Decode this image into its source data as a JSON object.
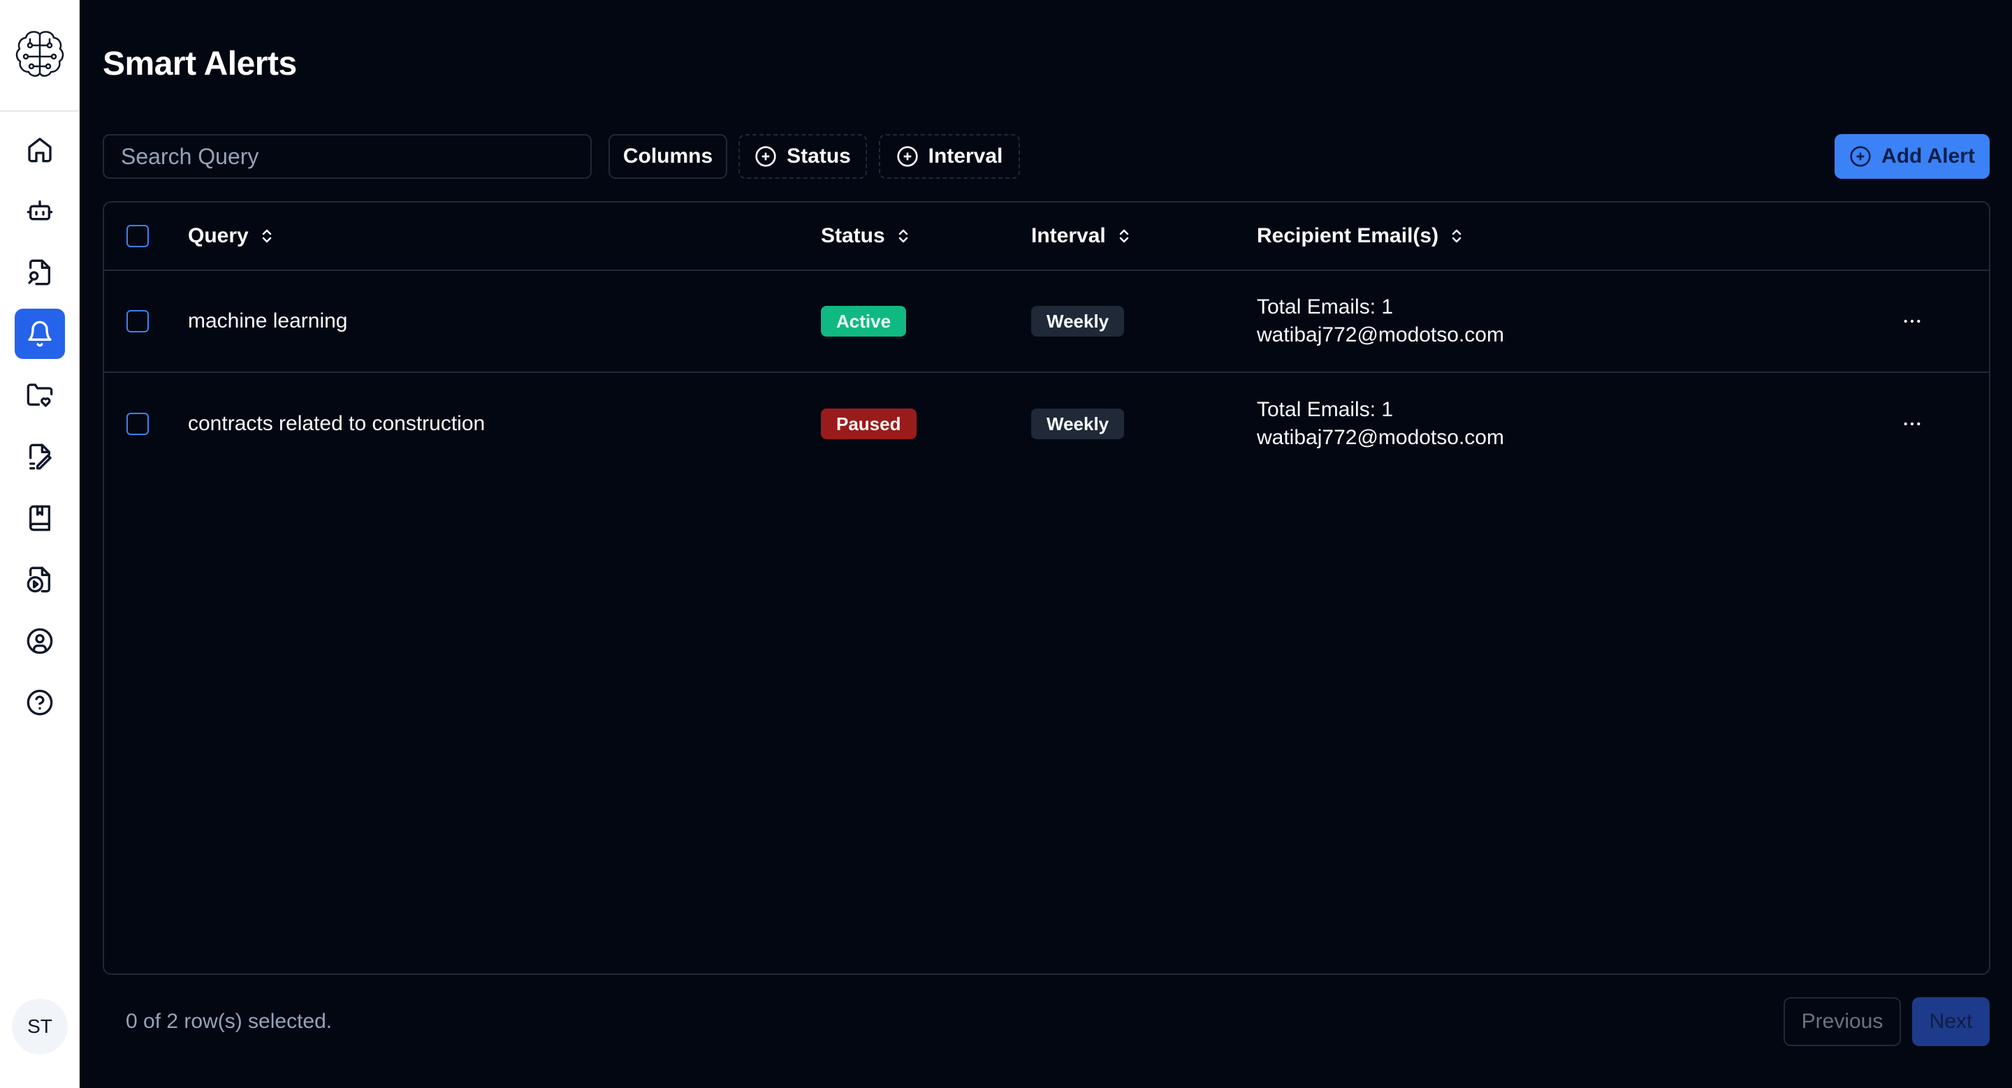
{
  "sidebar": {
    "logo_icon": "brain-icon",
    "items": [
      {
        "name": "home",
        "icon": "home-icon",
        "active": false
      },
      {
        "name": "bot",
        "icon": "bot-icon",
        "active": false
      },
      {
        "name": "file-search",
        "icon": "file-search-icon",
        "active": false
      },
      {
        "name": "alerts",
        "icon": "bell-icon",
        "active": true
      },
      {
        "name": "folder-heart",
        "icon": "folder-heart-icon",
        "active": false
      },
      {
        "name": "file-edit",
        "icon": "file-edit-icon",
        "active": false
      },
      {
        "name": "book",
        "icon": "book-icon",
        "active": false
      },
      {
        "name": "file-video",
        "icon": "file-video-icon",
        "active": false
      },
      {
        "name": "account",
        "icon": "user-circle-icon",
        "active": false
      },
      {
        "name": "help",
        "icon": "help-circle-icon",
        "active": false
      }
    ],
    "avatar_initials": "ST"
  },
  "page": {
    "title": "Smart Alerts"
  },
  "toolbar": {
    "search_placeholder": "Search Query",
    "columns_label": "Columns",
    "status_label": "Status",
    "interval_label": "Interval",
    "add_label": "Add Alert"
  },
  "table": {
    "headers": {
      "query": "Query",
      "status": "Status",
      "interval": "Interval",
      "recipients": "Recipient Email(s)"
    },
    "rows": [
      {
        "query": "machine learning",
        "status": "Active",
        "interval": "Weekly",
        "total": "Total Emails: 1",
        "email": "watibaj772@modotso.com"
      },
      {
        "query": "contracts related to construction",
        "status": "Paused",
        "interval": "Weekly",
        "total": "Total Emails: 1",
        "email": "watibaj772@modotso.com"
      }
    ]
  },
  "footer": {
    "selection": "0 of 2 row(s) selected.",
    "previous": "Previous",
    "next": "Next"
  },
  "colors": {
    "background": "#030712",
    "accent": "#3b82f6",
    "active": "#10b981",
    "paused": "#991b1b"
  }
}
